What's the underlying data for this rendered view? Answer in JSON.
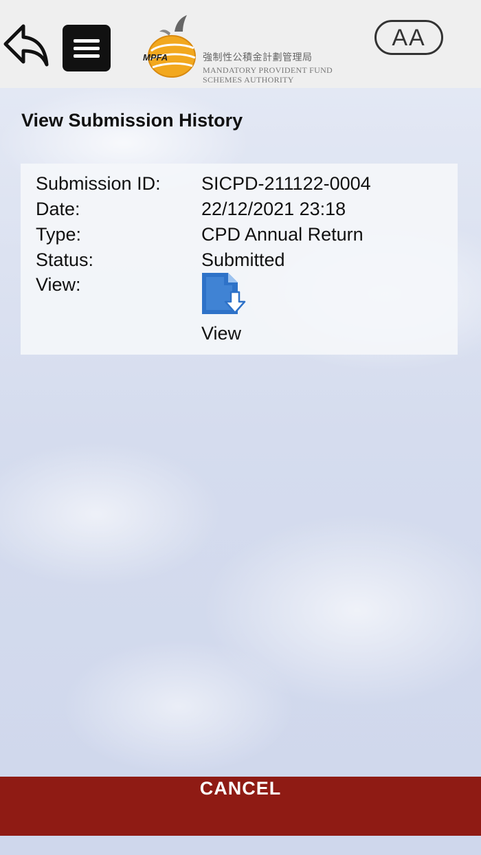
{
  "header": {
    "logo_cn": "強制性公積金計劃管理局",
    "logo_en_line1": "Mandatory Provident Fund",
    "logo_en_line2": "Schemes Authority",
    "logo_mark_text": "MPFA",
    "font_size_button": "AA"
  },
  "page": {
    "title": "View Submission History"
  },
  "submission": {
    "labels": {
      "id": "Submission ID:",
      "date": "Date:",
      "type": "Type:",
      "status": "Status:",
      "view": "View:"
    },
    "values": {
      "id": "SICPD-211122-0004",
      "date": "22/12/2021 23:18",
      "type": "CPD Annual Return",
      "status": "Submitted"
    },
    "view_link": "View"
  },
  "footer": {
    "cancel_label": "CANCEL"
  },
  "colors": {
    "cancel_bar": "#8f1b14",
    "logo_orange": "#f0a020",
    "doc_icon_blue": "#2e72c8"
  },
  "icons": {
    "back": "reply-arrow-icon",
    "menu": "hamburger-menu-icon",
    "view_document": "document-download-icon"
  }
}
